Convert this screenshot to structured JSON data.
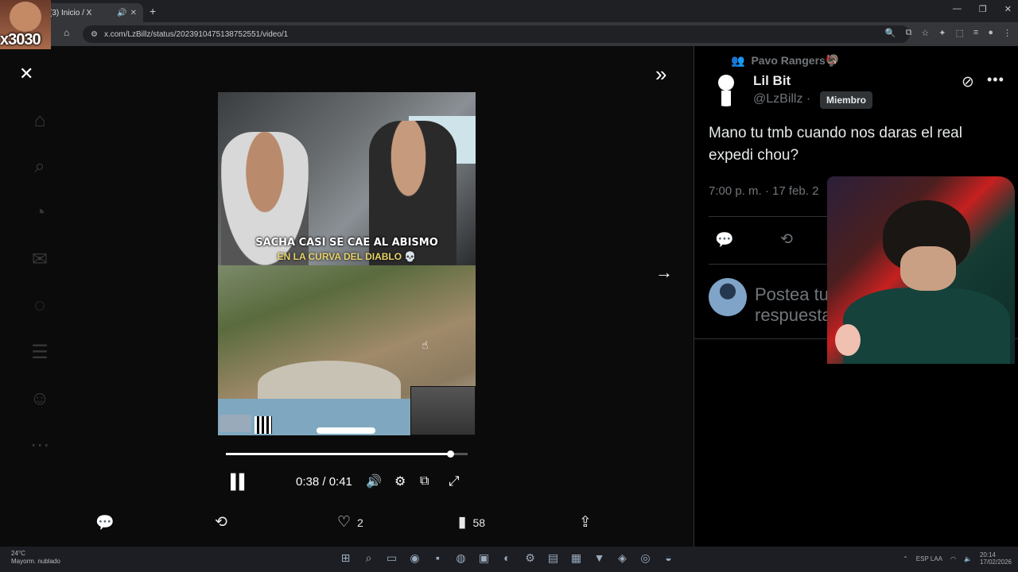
{
  "browser": {
    "tab_title": "(3) Inicio / X",
    "url": "x.com/LzBillz/status/2023910475138752551/video/1",
    "new_tab": "+",
    "window_controls": [
      "—",
      "❐",
      "✕"
    ]
  },
  "overlay": {
    "streamer_badge": "x3030"
  },
  "media": {
    "caption_line1": "SACHA CASI SE CAE AL ABISMO",
    "caption_line2": "EN LA CURVA DEL DIABLO 💀",
    "time_display": "0:38 / 0:41",
    "progress_fraction": 0.927
  },
  "actions": {
    "likes": "2",
    "views": "58"
  },
  "tweet": {
    "community": "Pavo Rangers🦃",
    "author_name": "Lil Bit",
    "author_handle": "@LzBillz ·",
    "member_badge": "Miembro",
    "text": "Mano tu tmb cuando nos daras el real expedi chou?",
    "timestamp": "7:00 p. m. · 17 feb. 2",
    "reply_placeholder": "Postea tu respuesta"
  },
  "taskbar": {
    "weather_temp": "24°C",
    "weather_desc": "Mayorm. nublado",
    "lang": "ESP LAA",
    "clock_time": "20:14",
    "clock_date": "17/02/2026"
  },
  "colors": {
    "accent": "#1d9bf0",
    "muted": "#71767b",
    "border": "#2f3336"
  }
}
